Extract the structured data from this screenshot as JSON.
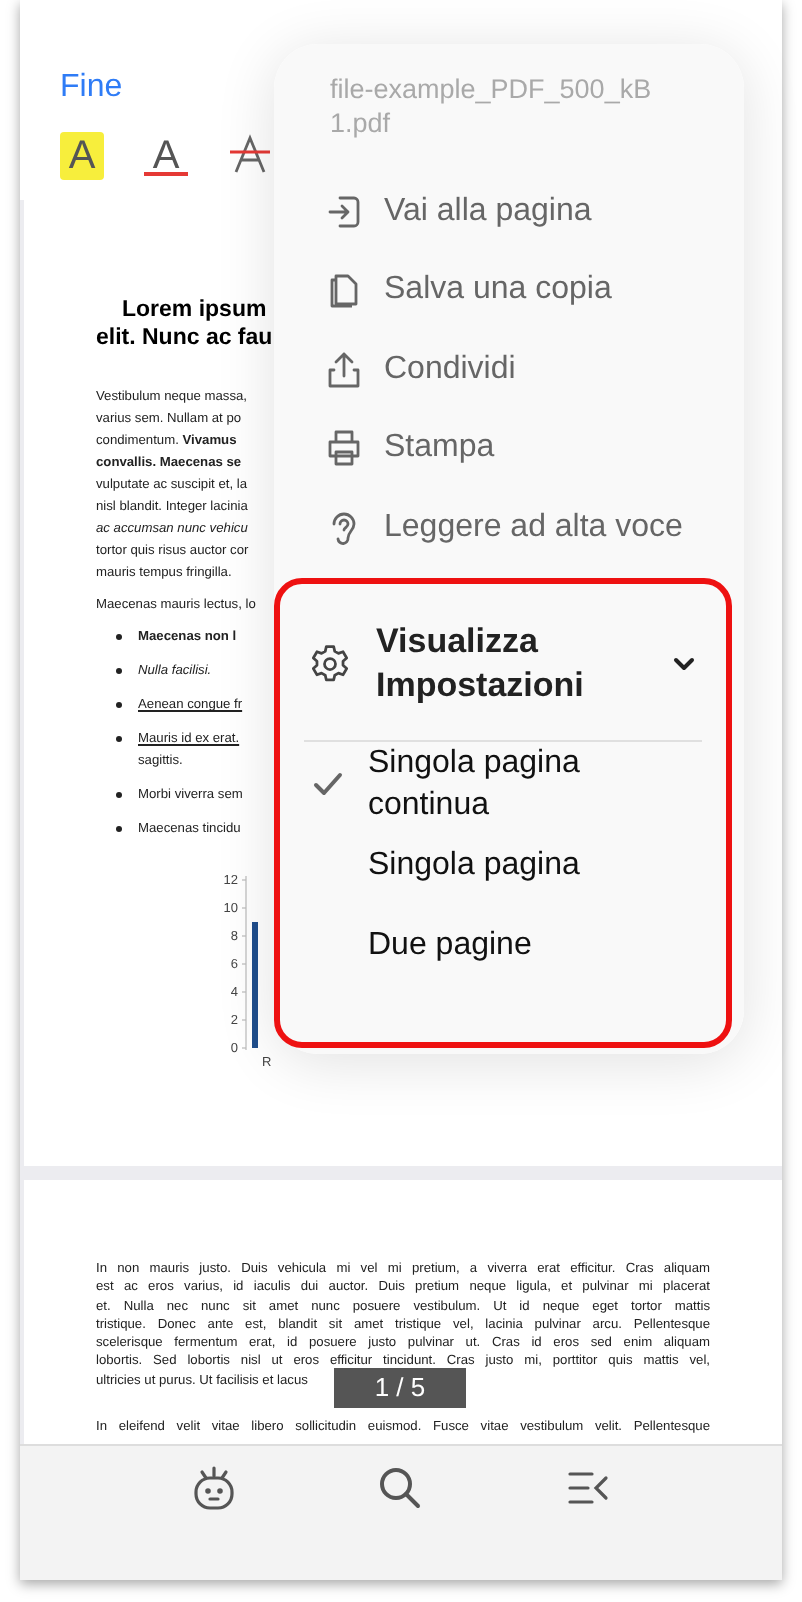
{
  "header": {
    "done_label": "Fine",
    "tools": [
      {
        "kind": "highlight",
        "label": "A"
      },
      {
        "kind": "underline",
        "label": "A"
      },
      {
        "kind": "strikethrough"
      }
    ]
  },
  "page_1": {
    "title_lines": [
      "Lorem ipsum",
      "elit. Nunc ac fau"
    ],
    "paragraph_lines": [
      "Vestibulum neque massa,",
      "varius sem. Nullam at po",
      "condimentum. **Vivamus**",
      "**convallis. Maecenas se**",
      "vulputate ac suscipit et, la",
      "nisl blandit. Integer lacinia",
      "*ac accumsan nunc vehicu*",
      "tortor quis risus auctor cor",
      "mauris tempus fringilla."
    ],
    "paragraph_2": "Maecenas mauris lectus, lo",
    "bullets": [
      {
        "kind": "bold",
        "lines": [
          "Maecenas non l"
        ]
      },
      {
        "kind": "italic",
        "lines": [
          "Nulla facilisi."
        ]
      },
      {
        "kind": "underline",
        "lines": [
          "Aenean congue fr"
        ]
      },
      {
        "kind": "underline",
        "lines": [
          "Mauris id ex erat."
        ],
        "tail": "sagittis."
      },
      {
        "kind": "plain",
        "lines": [
          "Morbi viverra sem"
        ]
      },
      {
        "kind": "plain",
        "lines": [
          "Maecenas tincidu"
        ]
      }
    ],
    "chart_data": {
      "type": "bar",
      "categories": [
        "R"
      ],
      "values": [
        9
      ],
      "ylim": [
        0,
        12
      ],
      "yticks": [
        0,
        2,
        4,
        6,
        8,
        10,
        12
      ]
    }
  },
  "page_2": {
    "lines": [
      "In non mauris justo. Duis vehicula mi vel mi pretium, a viverra erat efficitur. Cras aliquam",
      "est ac eros varius, id iaculis dui auctor. Duis pretium neque ligula, et pulvinar mi placerat",
      "et. Nulla nec nunc sit amet nunc posuere vestibulum. Ut id neque eget tortor mattis",
      "tristique. Donec ante est, blandit sit amet tristique vel, lacinia pulvinar arcu. Pellentesque",
      "scelerisque fermentum erat, id posuere justo pulvinar ut. Cras id eros sed enim aliquam",
      "lobortis. Sed lobortis nisl ut eros efficitur tincidunt. Cras justo mi, porttitor quis mattis vel,",
      "ultricies ut purus. Ut facilisis et lacus"
    ],
    "last_line": "In eleifend velit vitae libero sollicitudin euismod. Fusce vitae vestibulum velit. Pellentesque"
  },
  "page_indicator": "1 / 5",
  "menu": {
    "filename": "file-example_PDF_500_kB 1.pdf",
    "items": [
      "Vai alla pagina",
      "Salva una copia",
      "Condividi",
      "Stampa",
      "Leggere ad alta voce"
    ],
    "settings": {
      "title": "Visualizza Impostazioni",
      "expanded": true,
      "options": [
        {
          "label": "Singola pagina continua",
          "selected": true
        },
        {
          "label": "Singola pagina",
          "selected": false
        },
        {
          "label": "Due pagine",
          "selected": false
        }
      ]
    }
  }
}
